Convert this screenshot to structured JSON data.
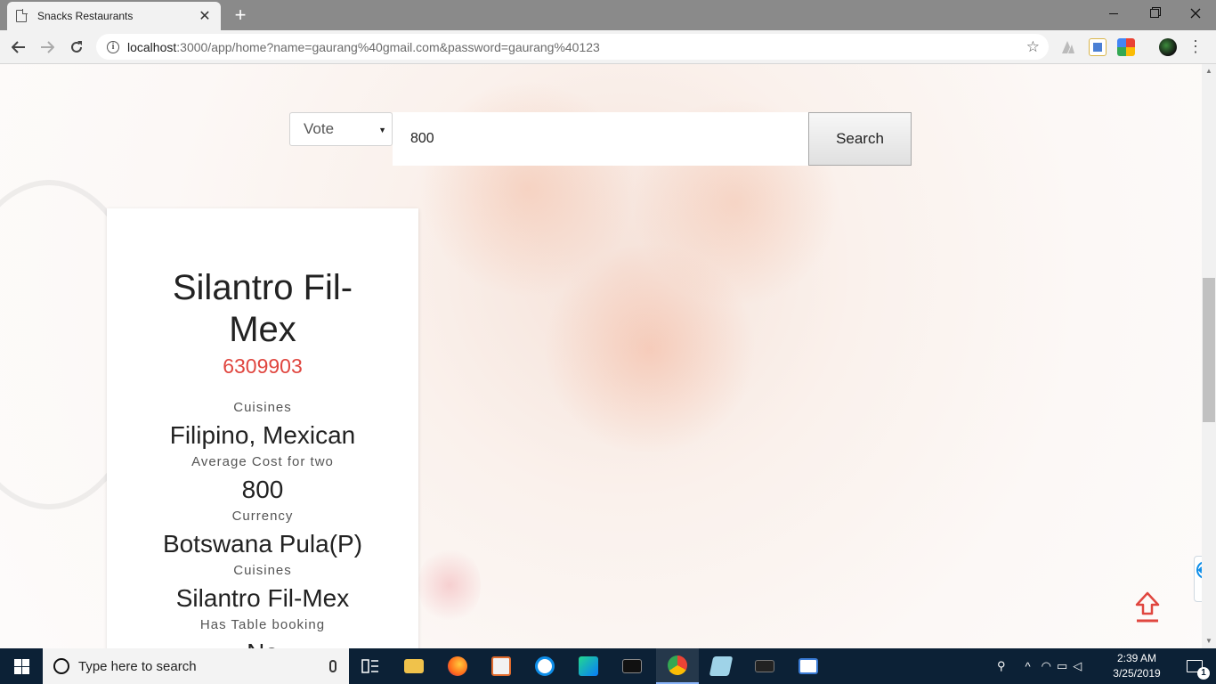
{
  "browser": {
    "tab_title": "Snacks Restaurants",
    "tab_close": "✕",
    "new_tab": "+",
    "url_host": "localhost",
    "url_rest": ":3000/app/home?name=gaurang%40gmail.com&password=gaurang%40123"
  },
  "search": {
    "filter_selected": "Vote",
    "query_value": "800",
    "button_label": "Search"
  },
  "restaurant": {
    "name": "Silantro Fil-Mex",
    "id": "6309903",
    "fields": [
      {
        "label": "Cuisines",
        "value": "Filipino, Mexican"
      },
      {
        "label": "Average Cost for two",
        "value": "800"
      },
      {
        "label": "Currency",
        "value": "Botswana Pula(P)"
      },
      {
        "label": "Cuisines",
        "value": "Silantro Fil-Mex"
      },
      {
        "label": "Has Table booking",
        "value": "No"
      }
    ]
  },
  "taskbar": {
    "search_placeholder": "Type here to search",
    "time": "2:39 AM",
    "date": "3/25/2019",
    "notification_count": "1"
  },
  "colors": {
    "accent_red": "#e0463f",
    "taskbar_bg": "#0c2136"
  }
}
